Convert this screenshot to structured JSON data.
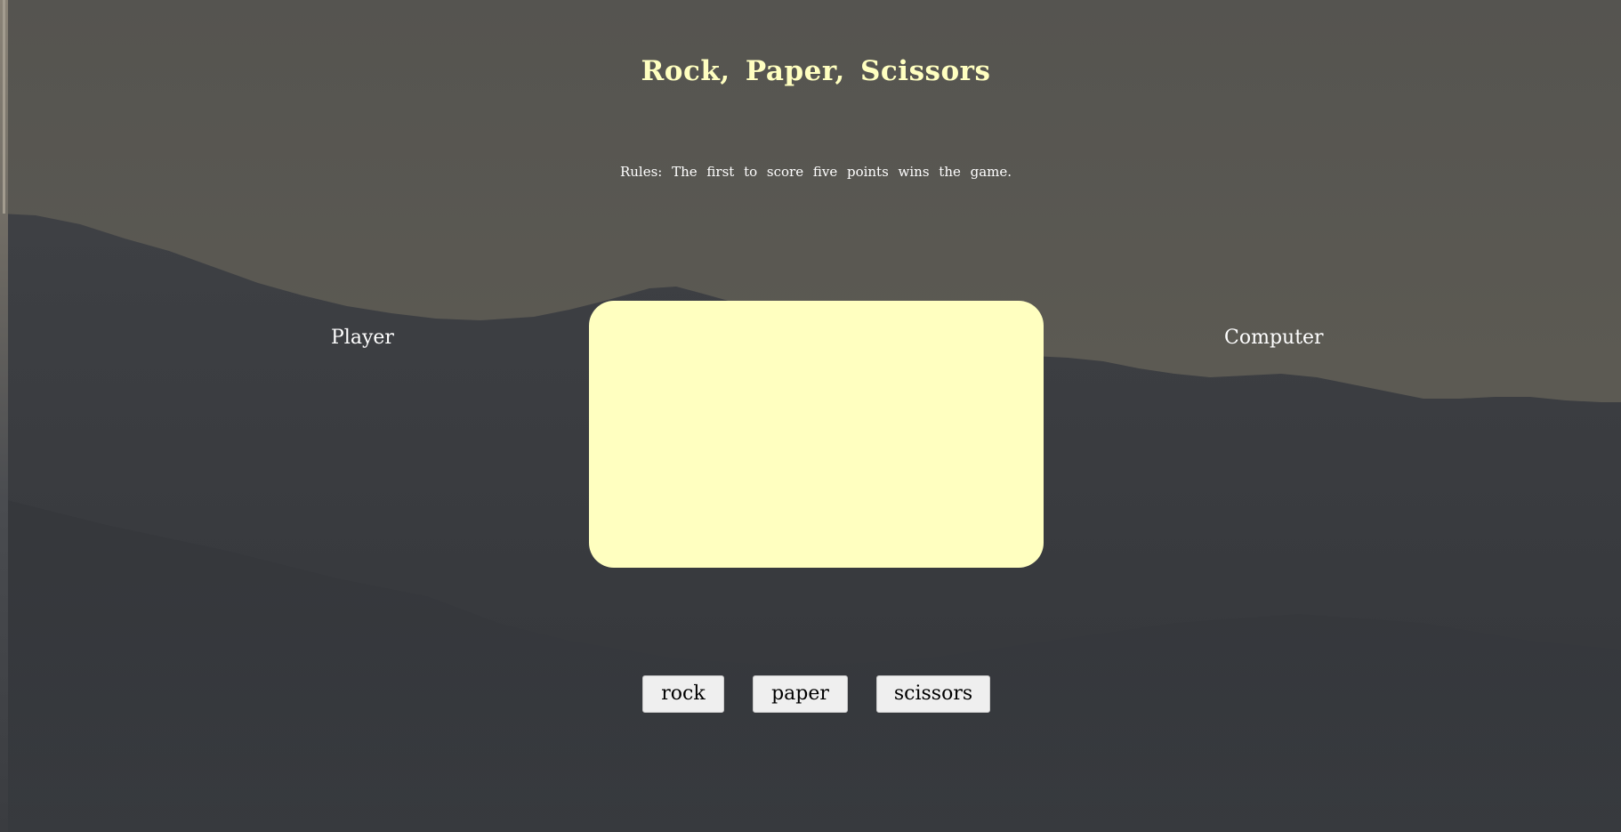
{
  "game": {
    "title": "Rock, Paper, Scissors",
    "rules": "Rules: The first to score five points wins the game.",
    "player_label": "Player",
    "computer_label": "Computer"
  },
  "controls": {
    "rock_label": "rock",
    "paper_label": "paper",
    "scissors_label": "scissors"
  },
  "colors": {
    "accent": "#ffffc0",
    "button_bg": "#efefef",
    "text": "#ffffff"
  }
}
